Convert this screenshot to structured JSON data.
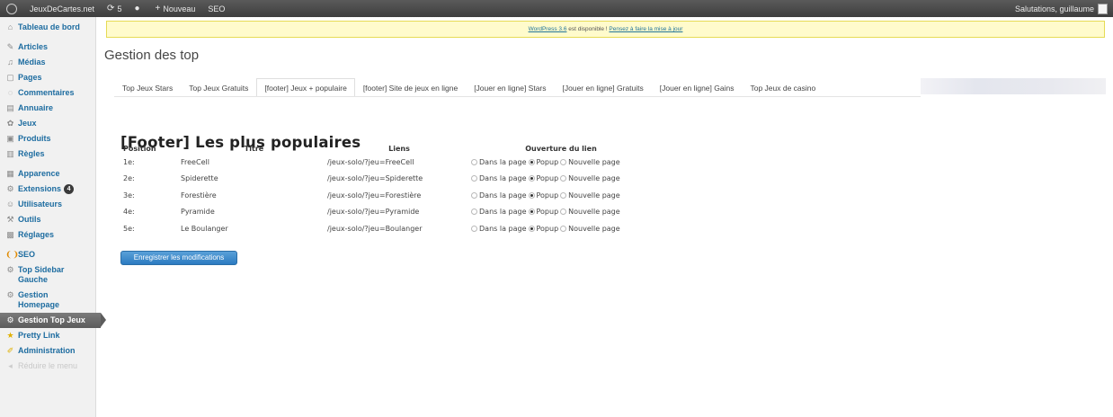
{
  "adminbar": {
    "site_name": "JeuxDeCartes.net",
    "updates_count": "5",
    "new_label": "Nouveau",
    "seo_label": "SEO",
    "greeting": "Salutations, guillaume"
  },
  "sidebar": {
    "items": [
      {
        "label": "Tableau de bord",
        "icon": "dashboard-icon"
      },
      {
        "label": "Articles",
        "icon": "pin-icon"
      },
      {
        "label": "Médias",
        "icon": "media-icon"
      },
      {
        "label": "Pages",
        "icon": "page-icon"
      },
      {
        "label": "Commentaires",
        "icon": "comment-icon"
      },
      {
        "label": "Annuaire",
        "icon": "directory-icon"
      },
      {
        "label": "Jeux",
        "icon": "games-icon"
      },
      {
        "label": "Produits",
        "icon": "products-icon"
      },
      {
        "label": "Règles",
        "icon": "rules-icon"
      },
      {
        "label": "Apparence",
        "icon": "appearance-icon"
      },
      {
        "label": "Extensions",
        "icon": "plugin-icon",
        "badge": "4"
      },
      {
        "label": "Utilisateurs",
        "icon": "users-icon"
      },
      {
        "label": "Outils",
        "icon": "tools-icon"
      },
      {
        "label": "Réglages",
        "icon": "settings-icon"
      },
      {
        "label": "SEO",
        "icon": "seo-icon"
      },
      {
        "label": "Top Sidebar Gauche",
        "icon": "gear-icon"
      },
      {
        "label": "Gestion Homepage",
        "icon": "gear-icon"
      },
      {
        "label": "Gestion Top Jeux",
        "icon": "gear-icon"
      },
      {
        "label": "Pretty Link",
        "icon": "star-icon"
      },
      {
        "label": "Administration",
        "icon": "admin-icon"
      },
      {
        "label": "Réduire le menu",
        "icon": "collapse-icon"
      }
    ]
  },
  "notice": {
    "link1": "WordPress 3.6",
    "text": " est disponible ! ",
    "link2": "Pensez à faire la mise à jour"
  },
  "page_title": "Gestion des top",
  "tabs": [
    "Top Jeux Stars",
    "Top Jeux Gratuits",
    "[footer] Jeux + populaire",
    "[footer] Site de jeux en ligne",
    "[Jouer en ligne] Stars",
    "[Jouer en ligne] Gratuits",
    "[Jouer en ligne] Gains",
    "Top Jeux de casino"
  ],
  "section_title": "[Footer] Les plus populaires",
  "table": {
    "headers": [
      "Position",
      "Titre",
      "Liens",
      "Ouverture du lien"
    ],
    "options": [
      "Dans la page",
      "Popup",
      "Nouvelle page"
    ],
    "rows": [
      {
        "pos": "1e:",
        "title": "FreeCell",
        "link": "/jeux-solo/?jeu=FreeCell",
        "selected": 1
      },
      {
        "pos": "2e:",
        "title": "Spiderette",
        "link": "/jeux-solo/?jeu=Spiderette",
        "selected": 1
      },
      {
        "pos": "3e:",
        "title": "Forestière",
        "link": "/jeux-solo/?jeu=Forestière",
        "selected": 1
      },
      {
        "pos": "4e:",
        "title": "Pyramide",
        "link": "/jeux-solo/?jeu=Pyramide",
        "selected": 1
      },
      {
        "pos": "5e:",
        "title": "Le Boulanger",
        "link": "/jeux-solo/?jeu=Boulanger",
        "selected": 1
      }
    ]
  },
  "save_label": "Enregistrer les modifications"
}
